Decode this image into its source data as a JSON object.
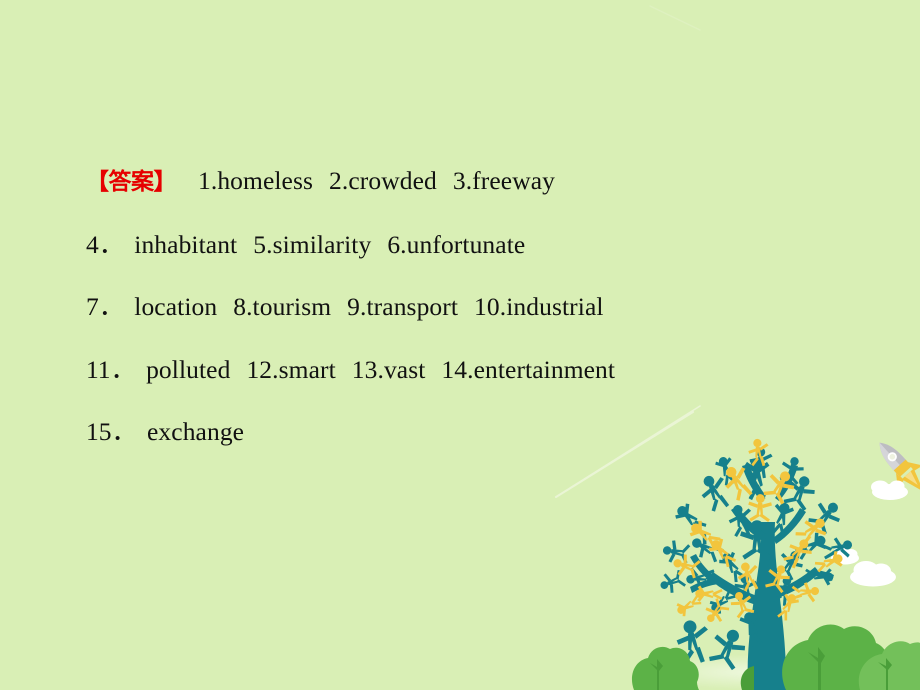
{
  "slide": {
    "background_color": "#d9efb5",
    "answer_label": "【答案】",
    "answer_label_color": "#e60000",
    "text_color": "#111111"
  },
  "answers": {
    "lines": [
      {
        "id": "line-1",
        "has_label": true,
        "items": [
          "1.homeless",
          "2.crowded",
          "3.freeway"
        ]
      },
      {
        "id": "line-2",
        "has_label": false,
        "lead": "4．",
        "items": [
          "inhabitant",
          "5.similarity",
          "6.unfortunate"
        ]
      },
      {
        "id": "line-3",
        "has_label": false,
        "lead": "7．",
        "items": [
          "location",
          "8.tourism",
          "9.transport",
          "10.industrial"
        ]
      },
      {
        "id": "line-4",
        "has_label": false,
        "lead": "11．",
        "items": [
          "polluted",
          "12.smart",
          "13.vast",
          "14.entertainment"
        ]
      },
      {
        "id": "line-5",
        "has_label": false,
        "lead": "15．",
        "items": [
          "exchange"
        ]
      }
    ],
    "flat_list": [
      "1.homeless",
      "2.crowded",
      "3.freeway",
      "4.inhabitant",
      "5.similarity",
      "6.unfortunate",
      "7.location",
      "8.tourism",
      "9.transport",
      "10.industrial",
      "11.polluted",
      "12.smart",
      "13.vast",
      "14.entertainment",
      "15.exchange"
    ]
  },
  "decoration": {
    "scene_name": "people-tree-illustration",
    "colors": {
      "teal": "#16808c",
      "teal_dark": "#127580",
      "yellow": "#f2c53d",
      "bush_green": "#5cb247",
      "bush_green_dark": "#4a9e39",
      "bush_green_light": "#73c05a",
      "cloud_white": "#ffffff",
      "rocket_body": "#b9b9bd",
      "rocket_fin": "#f2c53d",
      "streak_white": "#f2f7e4"
    },
    "elements": [
      {
        "name": "people-tree",
        "label": "tree made of human figures"
      },
      {
        "name": "rocket",
        "label": "rocket"
      },
      {
        "name": "cloud",
        "label": "cloud"
      },
      {
        "name": "bush",
        "label": "bush"
      },
      {
        "name": "contrail-streak",
        "label": "diagonal streak"
      }
    ]
  }
}
